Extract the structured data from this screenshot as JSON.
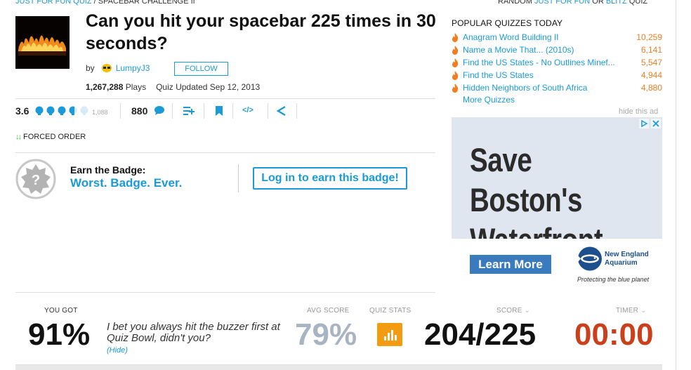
{
  "crumb": {
    "category": "JUST FOR FUN QUIZ",
    "sep": " / ",
    "current": "SPACEBAR CHALLENGE II"
  },
  "random": {
    "prefix": "RANDOM ",
    "link1": "JUST FOR FUN",
    "or": " OR ",
    "link2": "BLITZ",
    "suffix": " QUIZ"
  },
  "quiz": {
    "title": "Can you hit your spacebar 225 times in 30 seconds?",
    "by": "by",
    "author": "LumpyJ3",
    "follow": "FOLLOW",
    "plays_count": "1,267,288",
    "plays_label": "Plays",
    "updated": "Quiz Updated Sep 12, 2013"
  },
  "toolbar": {
    "rating": "3.6",
    "rating_count": "1,088",
    "rating_level": 3.6,
    "comments": "880",
    "icons": [
      "add-to-playlist-icon",
      "bookmark-icon",
      "embed-icon",
      "share-icon"
    ],
    "embed_text": "</>"
  },
  "forced": {
    "arrows": "↓↓",
    "label": "FORCED ORDER"
  },
  "badge": {
    "earn": "Earn the Badge:",
    "name": "Worst. Badge. Ever.",
    "login": "Log in to earn this badge!"
  },
  "sidebar": {
    "title": "POPULAR QUIZZES TODAY",
    "items": [
      {
        "name": "Anagram Word Building II",
        "count": "10,259"
      },
      {
        "name": "Name a Movie That... (2010s)",
        "count": "6,141"
      },
      {
        "name": "Find the US States - No Outlines Minef...",
        "count": "5,547"
      },
      {
        "name": "Find the US States",
        "count": "4,944"
      },
      {
        "name": "Hidden Neighbors of South Africa",
        "count": "4,880"
      }
    ],
    "more": "More Quizzes",
    "hide_ad": "hide this ad"
  },
  "ad": {
    "headline": "Save Boston's Waterfront",
    "cta": "Learn More",
    "org": "New England Aquarium",
    "org_line1": "New England",
    "org_line2": "Aquarium",
    "tagline": "Protecting the blue planet"
  },
  "score": {
    "you_got_label": "YOU GOT",
    "you_got": "91%",
    "message": "I bet you always hit the buzzer first at Quiz Bowl, didn't you?",
    "hide": "(Hide)",
    "avg_label": "AVG SCORE",
    "avg": "79%",
    "stats_label": "QUIZ STATS",
    "score_label": "SCORE",
    "score": "204/225",
    "timer_label": "TIMER",
    "timer": "00:00"
  },
  "colors": {
    "link": "#1a9bd7",
    "orange": "#ef7d22",
    "timer": "#c8401c",
    "avg": "#a9b4c2",
    "stats": "#f39c12"
  }
}
